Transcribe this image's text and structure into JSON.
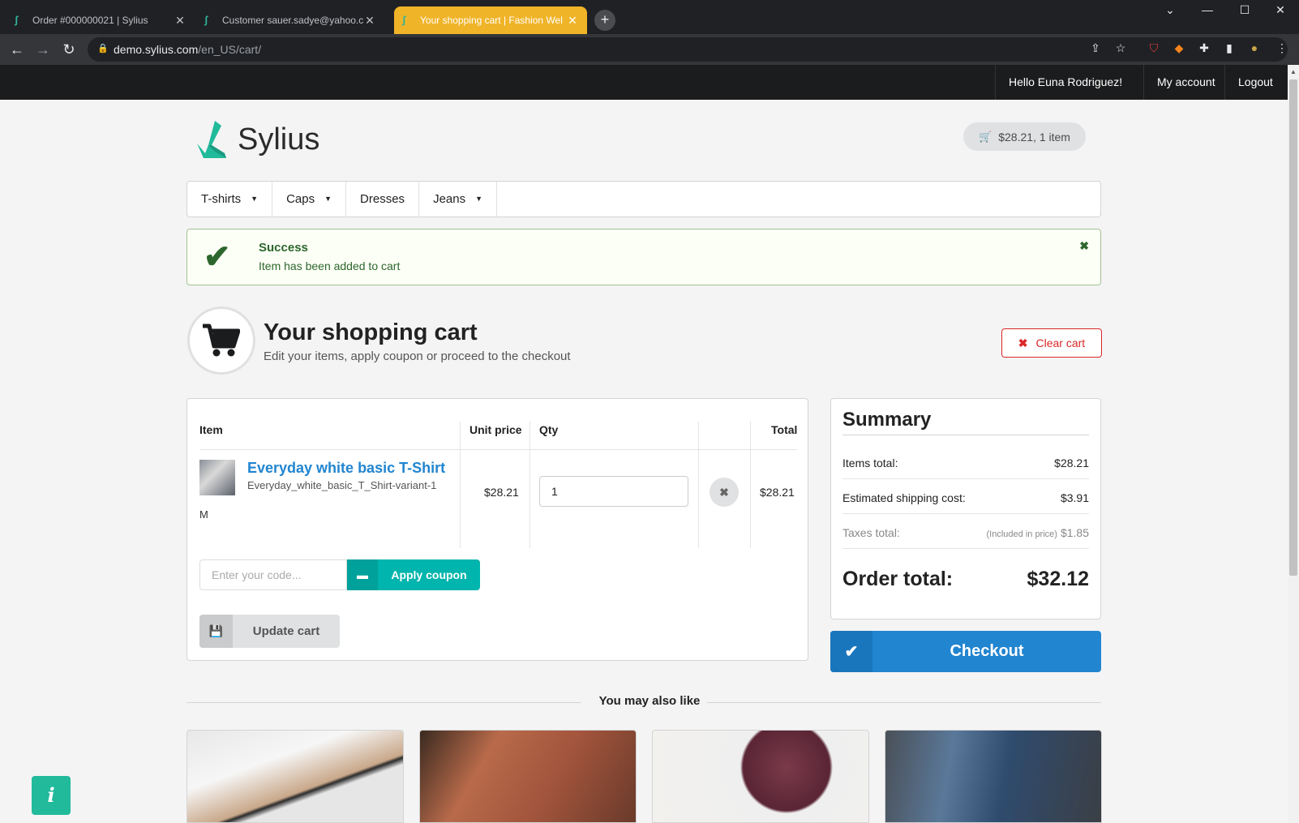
{
  "browser": {
    "tabs": [
      {
        "title": "Order #000000021 | Sylius",
        "active": false
      },
      {
        "title": "Customer sauer.sadye@yahoo.co",
        "active": false
      },
      {
        "title": "Your shopping cart | Fashion Wel",
        "active": true
      }
    ],
    "url_host": "demo.sylius.com",
    "url_path": "/en_US/cart/"
  },
  "topbar": {
    "greeting": "Hello Euna Rodriguez!",
    "my_account": "My account",
    "logout": "Logout"
  },
  "header": {
    "logo_text": "Sylius",
    "cart_summary": "$28.21, 1 item"
  },
  "menu": [
    {
      "label": "T-shirts",
      "dropdown": true
    },
    {
      "label": "Caps",
      "dropdown": true
    },
    {
      "label": "Dresses",
      "dropdown": false
    },
    {
      "label": "Jeans",
      "dropdown": true
    }
  ],
  "flash": {
    "title": "Success",
    "text": "Item has been added to cart"
  },
  "cart_header": {
    "title": "Your shopping cart",
    "subtitle": "Edit your items, apply coupon or proceed to the checkout",
    "clear_label": "Clear cart"
  },
  "table": {
    "col_item": "Item",
    "col_unit_price": "Unit price",
    "col_qty": "Qty",
    "col_total": "Total",
    "rows": [
      {
        "name": "Everyday white basic T-Shirt",
        "variant": "Everyday_white_basic_T_Shirt-variant-1",
        "option": "M",
        "unit_price": "$28.21",
        "qty": "1",
        "total": "$28.21"
      }
    ]
  },
  "coupon": {
    "placeholder": "Enter your code...",
    "apply_label": "Apply coupon"
  },
  "update_label": "Update cart",
  "summary": {
    "title": "Summary",
    "items_total_label": "Items total:",
    "items_total": "$28.21",
    "shipping_label": "Estimated shipping cost:",
    "shipping": "$3.91",
    "taxes_label": "Taxes total:",
    "taxes_note": "(Included in price)",
    "taxes": "$1.85",
    "order_total_label": "Order total:",
    "order_total": "$32.12"
  },
  "checkout_label": "Checkout",
  "also_like": "You may also like",
  "colors": {
    "brand_teal": "#21ba9b",
    "primary_blue": "#2185d0",
    "danger_red": "#db2828",
    "success_green": "#2c662d",
    "coupon_teal": "#00b5ad"
  }
}
